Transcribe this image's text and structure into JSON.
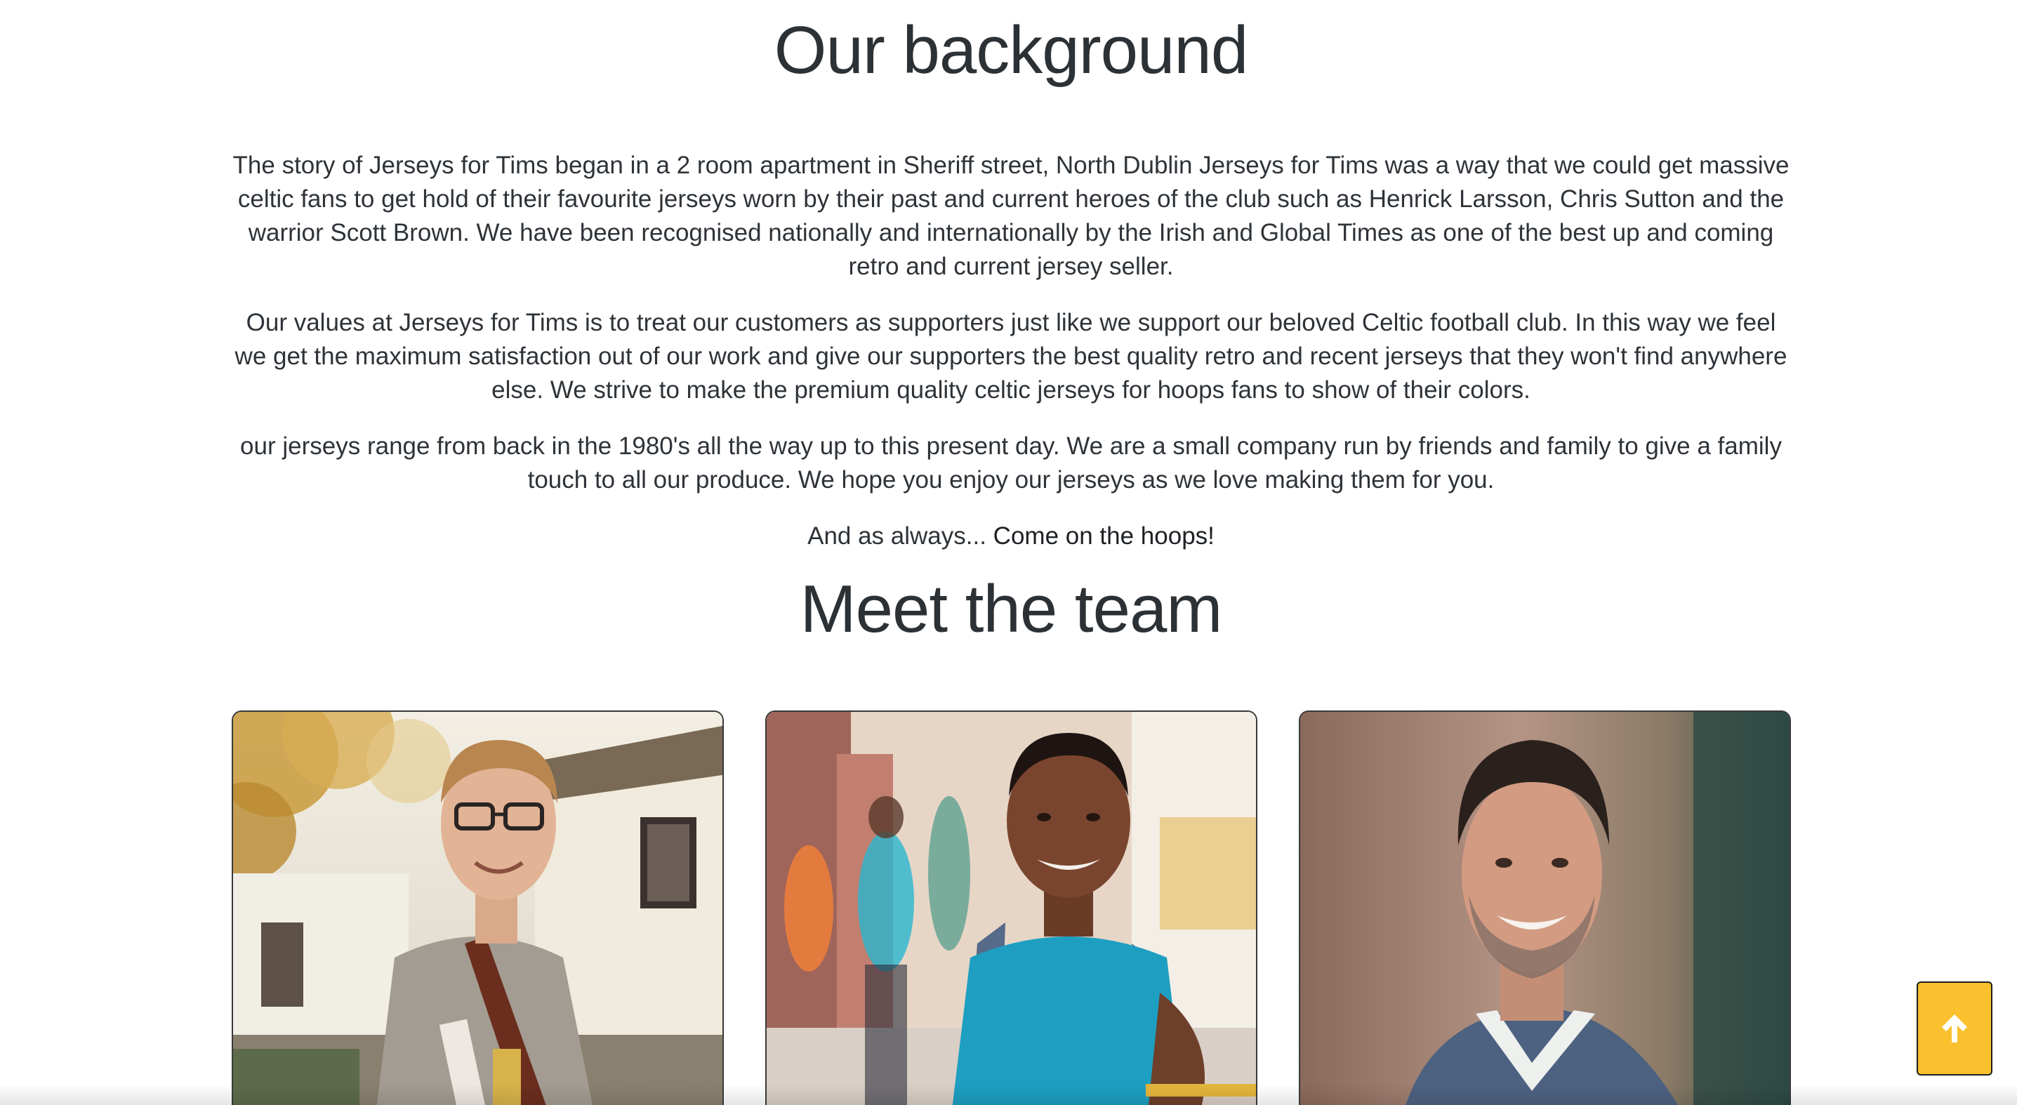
{
  "background": {
    "heading": "Our background",
    "paragraphs": [
      "The story of Jerseys for Tims began in a 2 room apartment in Sheriff street, North Dublin Jerseys for Tims was a way that we could get massive celtic fans to get hold of their favourite jerseys worn by their past and current heroes of the club such as Henrick Larsson, Chris Sutton and the warrior Scott Brown. We have been recognised nationally and internationally by the Irish and Global Times as one of the best up and coming retro and current jersey seller.",
      "Our values at Jerseys for Tims is to treat our customers as supporters just like we support our beloved Celtic football club. In this way we feel we get the maximum satisfaction out of our work and give our supporters the best quality retro and recent jerseys that they won't find anywhere else. We strive to make the premium quality celtic jerseys for hoops fans to show of their colors.",
      "our jerseys range from back in the 1980's all the way up to this present day. We are a small company run by friends and family to give a family touch to all our produce. We hope you enjoy our jerseys as we love making them for you."
    ],
    "closing_lead": "And as always...",
    "closing_emphasis": "Come on the hoops!"
  },
  "team": {
    "heading": "Meet the team",
    "members": [
      {
        "photo": "team-photo-glasses-man"
      },
      {
        "photo": "team-photo-young-man-backpack"
      },
      {
        "photo": "team-photo-smiling-man-grey-sweater"
      }
    ]
  },
  "back_to_top": {
    "icon": "arrow-up-icon",
    "color": "#fbc02d"
  }
}
